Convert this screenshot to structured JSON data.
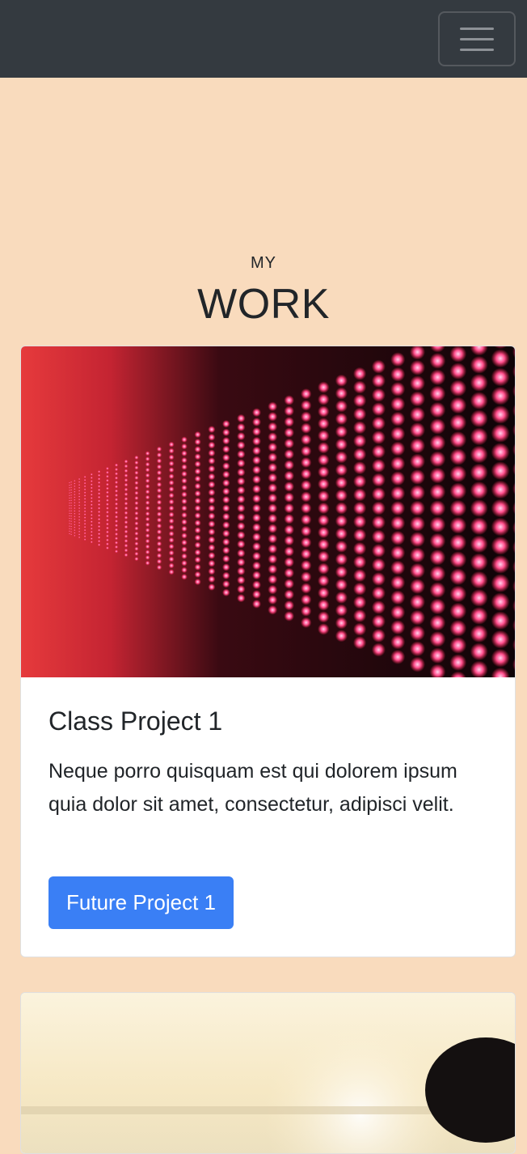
{
  "navbar": {
    "toggler_icon": "hamburger-menu-icon",
    "background": "#343a40"
  },
  "work": {
    "kicker": "MY",
    "title": "WORK"
  },
  "cards": [
    {
      "image": "red-led-wall-image",
      "title": "Class Project 1",
      "text": "Neque porro quisquam est qui dolorem ipsum quia dolor sit amet, consectetur, adipisci velit.",
      "button_label": "Future Project 1"
    },
    {
      "image": "sunset-silhouette-image"
    }
  ],
  "colors": {
    "page_background": "#f9dbbd",
    "primary_button": "#3a7ff5",
    "card_background": "#ffffff"
  }
}
